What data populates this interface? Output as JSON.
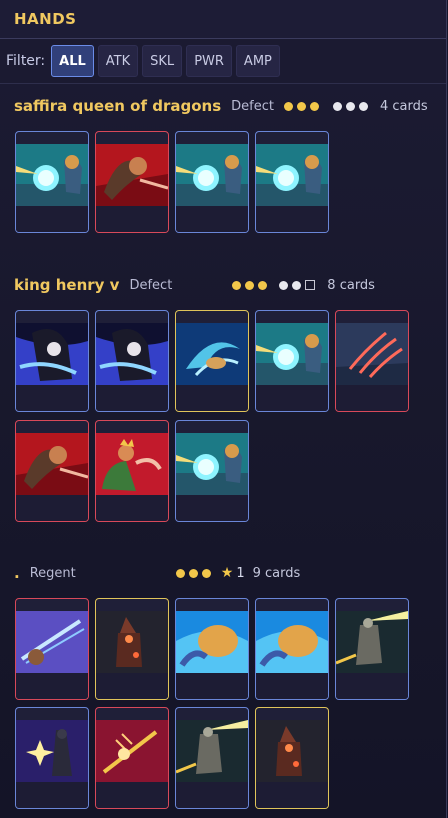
{
  "title": "HANDS",
  "filter": {
    "label": "Filter:",
    "buttons": [
      "ALL",
      "ATK",
      "SKL",
      "PWR",
      "AMP"
    ],
    "active": "ALL"
  },
  "players": [
    {
      "name": "saffira queen of dragons",
      "class": "Defect",
      "count": "4 cards",
      "cards": [
        {
          "art": "lightning-punch",
          "type": "skill"
        },
        {
          "art": "red-fist-strike",
          "type": "attack"
        },
        {
          "art": "lightning-punch",
          "type": "skill"
        },
        {
          "art": "lightning-punch",
          "type": "skill"
        }
      ]
    },
    {
      "name": "king henry v",
      "class": "Defect",
      "count": "8 cards",
      "cards": [
        {
          "art": "hooded-caster",
          "type": "skill"
        },
        {
          "art": "hooded-caster",
          "type": "skill"
        },
        {
          "art": "water-swirl",
          "type": "power"
        },
        {
          "art": "lightning-punch",
          "type": "skill"
        },
        {
          "art": "claw-marks",
          "type": "attack"
        },
        {
          "art": "red-fist-strike",
          "type": "attack"
        },
        {
          "art": "crowned-brawler",
          "type": "attack"
        },
        {
          "art": "lightning-punch",
          "type": "skill"
        }
      ]
    },
    {
      "name": ".",
      "class": "Regent",
      "stars": "1",
      "count": "9 cards",
      "cards": [
        {
          "art": "sword-slash",
          "type": "attack"
        },
        {
          "art": "dark-wizard",
          "type": "power"
        },
        {
          "art": "golden-boulder",
          "type": "skill"
        },
        {
          "art": "golden-boulder",
          "type": "skill"
        },
        {
          "art": "armored-beam",
          "type": "skill"
        },
        {
          "art": "starburst-knight",
          "type": "skill"
        },
        {
          "art": "thrown-sword",
          "type": "attack"
        },
        {
          "art": "armored-beam",
          "type": "skill"
        },
        {
          "art": "dark-wizard",
          "type": "power"
        }
      ]
    }
  ],
  "colors": {
    "gold": "#f0c860",
    "attack_border": "#d8495a",
    "skill_border": "#6a86d8",
    "power_border": "#e0c45a",
    "active_filter": "#31407a"
  }
}
